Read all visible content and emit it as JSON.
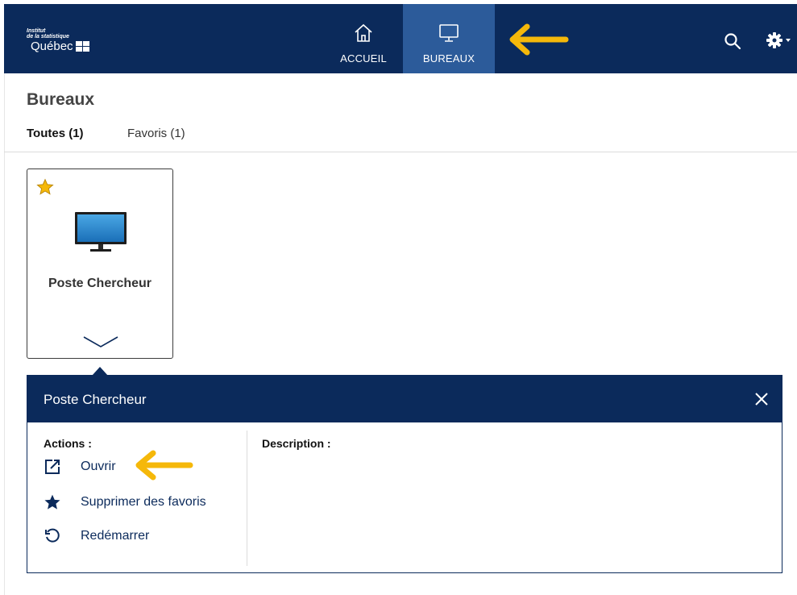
{
  "header": {
    "logo_line1": "Institut",
    "logo_line2": "de la statistique",
    "logo_name": "Québec",
    "nav": [
      {
        "label": "ACCUEIL",
        "icon": "home-icon"
      },
      {
        "label": "BUREAUX",
        "icon": "monitor-icon",
        "active": true
      }
    ],
    "icons": [
      "search-icon",
      "gear-icon"
    ]
  },
  "page": {
    "title": "Bureaux",
    "tabs": [
      {
        "label": "Toutes (1)",
        "active": true
      },
      {
        "label": "Favoris (1)"
      }
    ]
  },
  "desktops": [
    {
      "name": "Poste Chercheur",
      "favorite": true
    }
  ],
  "detail": {
    "title": "Poste Chercheur",
    "actions_label": "Actions :",
    "actions": [
      {
        "label": "Ouvrir",
        "icon": "external-link-icon"
      },
      {
        "label": "Supprimer des favoris",
        "icon": "star-icon"
      },
      {
        "label": "Redémarrer",
        "icon": "restart-icon"
      }
    ],
    "description_label": "Description :"
  },
  "colors": {
    "header_bg": "#0b2a5b",
    "active_tab": "#2c5b9a",
    "annotation_arrow": "#f5b80a"
  }
}
